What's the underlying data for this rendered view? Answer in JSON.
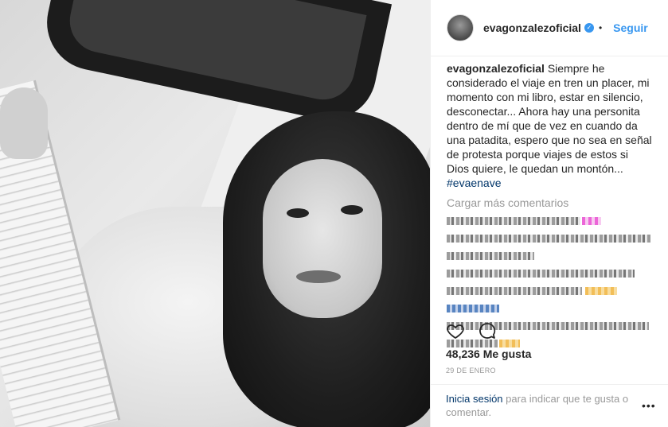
{
  "post": {
    "username": "evagonzalezoficial",
    "verified_symbol": "✓",
    "separator": "•",
    "follow_label": "Seguir",
    "caption_user": "evagonzalezoficial",
    "caption_text": " Siempre he considerado el viaje en tren un placer, mi momento con mi libro, estar en silencio, desconectar... Ahora hay una personita dentro de mí que de vez en cuando da una patadita, espero que no sea en señal de protesta porque viajes de estos si Dios quiere, le quedan un montón... ",
    "hashtag": "#evaenave",
    "load_more": "Cargar más comentarios",
    "likes": "48,236 Me gusta",
    "date": "29 DE ENERO",
    "login_link": "Inicia sesión",
    "login_text": " para indicar que te gusta o comentar.",
    "more_options": "•••"
  },
  "icons": {
    "like": "heart-icon",
    "comment": "comment-icon",
    "verified": "verified-badge-icon"
  },
  "colors": {
    "accent": "#3897f0",
    "link": "#003569",
    "muted": "#999999",
    "text": "#262626"
  }
}
